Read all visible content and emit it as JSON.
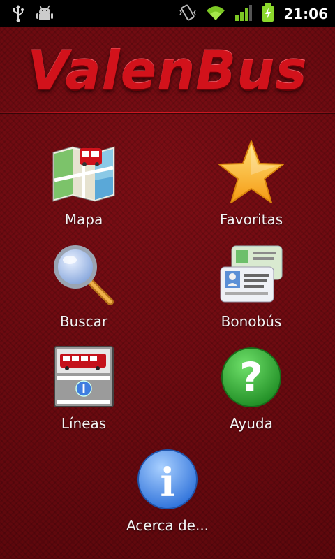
{
  "status_bar": {
    "time": "21:06",
    "left_icons": [
      "usb-icon",
      "android-debug-icon"
    ],
    "right_icons": [
      "vibrate-icon",
      "wifi-icon",
      "signal-icon",
      "battery-charging-icon"
    ]
  },
  "app": {
    "title": "ValenBus",
    "colors": {
      "background": "#6e0a10",
      "logo": "#d2121b",
      "label": "#f3f3f3"
    }
  },
  "menu": {
    "items": [
      {
        "label": "Mapa",
        "icon": "map-bus-icon"
      },
      {
        "label": "Favoritas",
        "icon": "star-icon"
      },
      {
        "label": "Buscar",
        "icon": "magnifier-icon"
      },
      {
        "label": "Bonobús",
        "icon": "id-cards-icon"
      },
      {
        "label": "Líneas",
        "icon": "bus-stop-info-icon"
      },
      {
        "label": "Ayuda",
        "icon": "help-icon"
      },
      {
        "label": "Acerca de...",
        "icon": "info-icon"
      }
    ]
  }
}
